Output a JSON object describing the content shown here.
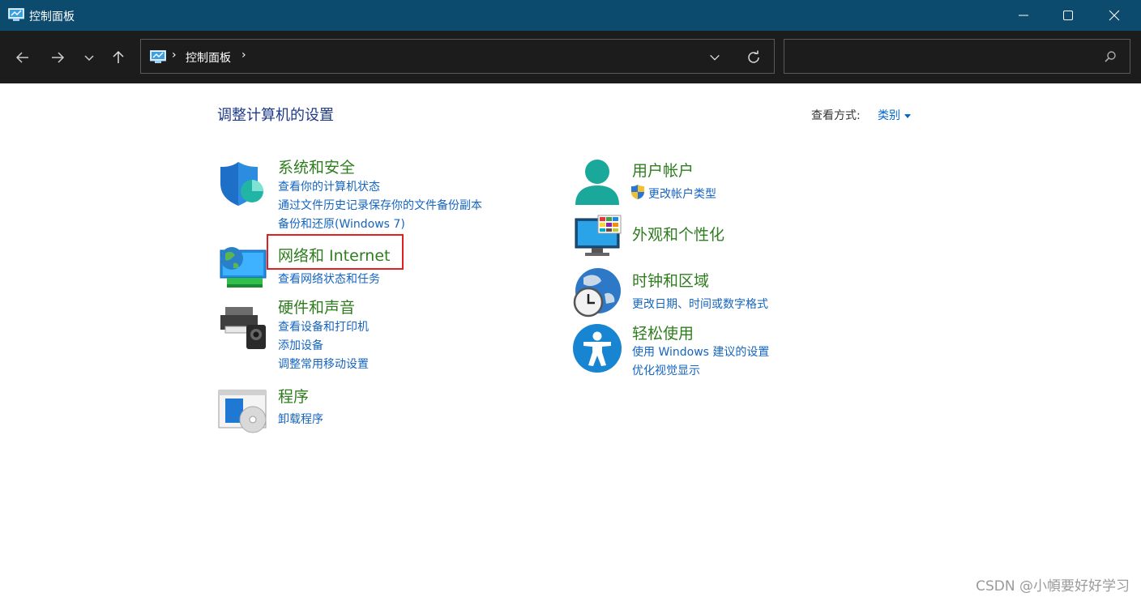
{
  "window": {
    "title": "控制面板"
  },
  "address": {
    "crumb": "控制面板",
    "separator": "›"
  },
  "search": {
    "placeholder": ""
  },
  "main": {
    "heading": "调整计算机的设置",
    "view_by_label": "查看方式:",
    "view_by_value": "类别"
  },
  "categories": {
    "system": {
      "title": "系统和安全",
      "links": [
        "查看你的计算机状态",
        "通过文件历史记录保存你的文件备份副本",
        "备份和还原(Windows 7)"
      ]
    },
    "network": {
      "title": "网络和 Internet",
      "links": [
        "查看网络状态和任务"
      ]
    },
    "hardware": {
      "title": "硬件和声音",
      "links": [
        "查看设备和打印机",
        "添加设备",
        "调整常用移动设置"
      ]
    },
    "programs": {
      "title": "程序",
      "links": [
        "卸载程序"
      ]
    },
    "users": {
      "title": "用户帐户",
      "links": [
        "更改帐户类型"
      ]
    },
    "appearance": {
      "title": "外观和个性化",
      "links": []
    },
    "clock": {
      "title": "时钟和区域",
      "links": [
        "更改日期、时间或数字格式"
      ]
    },
    "ease": {
      "title": "轻松使用",
      "links": [
        "使用 Windows 建议的设置",
        "优化视觉显示"
      ]
    }
  },
  "watermark": "CSDN @小幁要好好学习",
  "colors": {
    "titlebar": "#0c4a6e",
    "navbar": "#1c1c1c",
    "category_title": "#2e7d1e",
    "link": "#1565c0",
    "highlight": "#e02020"
  }
}
